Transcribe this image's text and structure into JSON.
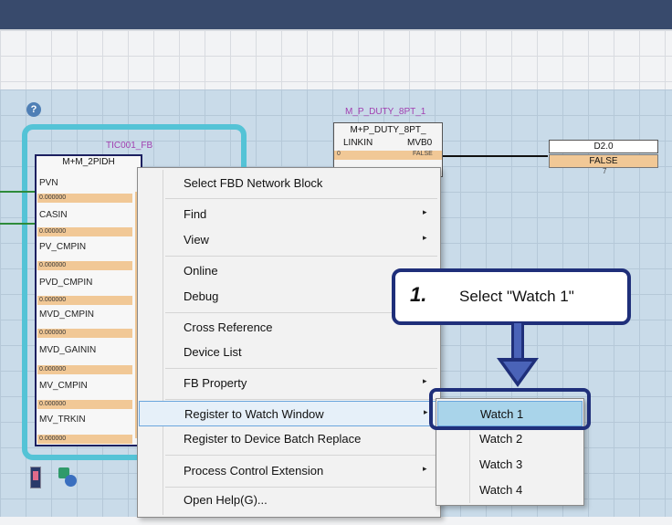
{
  "colors": {
    "titlebar": "#384a6c",
    "canvas": "#c9dbe9",
    "fb_outline": "#54c3d6",
    "callout_border": "#1f2f7a",
    "pin_value": "#f1c896",
    "selection": "#a9d4ea"
  },
  "fb": {
    "instance": "TIC001_FB",
    "type": "M+M_2PIDH",
    "pins": [
      {
        "label": "PVN",
        "value": "0.000000"
      },
      {
        "label": "CASIN",
        "value": "0.000000"
      },
      {
        "label": "PV_CMPIN",
        "value": "0.000000"
      },
      {
        "label": "PVD_CMPIN",
        "value": "0.000000"
      },
      {
        "label": "MVD_CMPIN",
        "value": "0.000000"
      },
      {
        "label": "MVD_GAININ",
        "value": "0.000000"
      },
      {
        "label": "MV_CMPIN",
        "value": "0.000000"
      },
      {
        "label": "MV_TRKIN",
        "value": "0.000000"
      }
    ]
  },
  "mp_block": {
    "instance": "M_P_DUTY_8PT_1",
    "type": "M+P_DUTY_8PT_",
    "in_pin": "LINKIN",
    "out_pin": "MVB0",
    "in_value": "0",
    "out_value": "FALSE"
  },
  "output": {
    "device": "D2.0",
    "value": "FALSE"
  },
  "help_icon": "question-icon",
  "context_menu": {
    "items": [
      {
        "label": "Select FBD Network Block",
        "has_submenu": false
      },
      {
        "label": "Find",
        "has_submenu": true
      },
      {
        "label": "View",
        "has_submenu": true
      },
      {
        "label": "Online",
        "has_submenu": false
      },
      {
        "label": "Debug",
        "has_submenu": false
      },
      {
        "label": "Cross Reference",
        "has_submenu": false
      },
      {
        "label": "Device List",
        "has_submenu": false
      },
      {
        "label": "FB Property",
        "has_submenu": true
      },
      {
        "label": "Register to Watch Window",
        "has_submenu": true
      },
      {
        "label": "Register to Device Batch Replace",
        "has_submenu": false
      },
      {
        "label": "Process Control Extension",
        "has_submenu": true
      },
      {
        "label": "Open Help(G)...",
        "has_submenu": false
      }
    ],
    "submenu_glyph": "▸"
  },
  "watch_submenu": {
    "items": [
      "Watch 1",
      "Watch 2",
      "Watch 3",
      "Watch 4"
    ],
    "selected": "Watch 1"
  },
  "callout": {
    "step": "1.",
    "text": "Select \"Watch 1\""
  }
}
